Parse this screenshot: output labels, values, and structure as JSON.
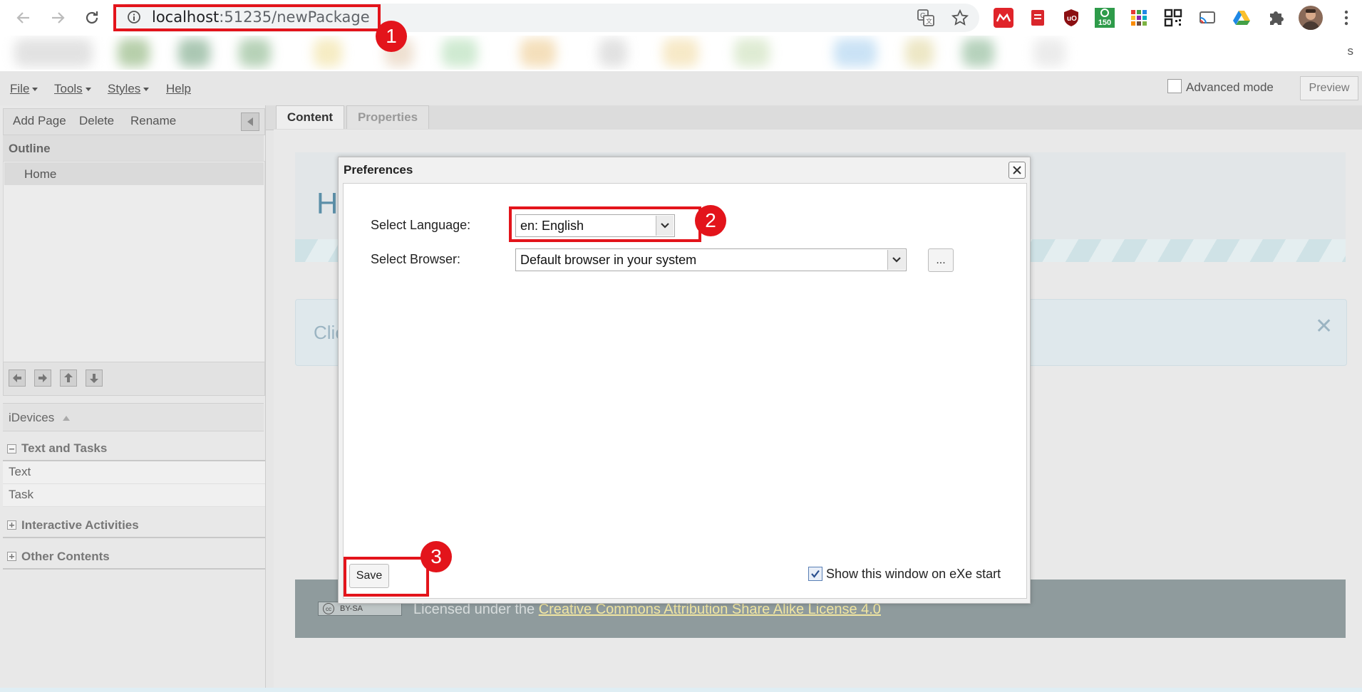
{
  "browser": {
    "url_host": "localhost",
    "url_path": ":51235/newPackage",
    "extension_badge": "150",
    "bookmarks_overflow": "s"
  },
  "menu": {
    "file": "File",
    "tools": "Tools",
    "styles": "Styles",
    "help": "Help",
    "advanced_mode": "Advanced mode",
    "preview": "Preview"
  },
  "outline": {
    "toolbar": {
      "add_page": "Add Page",
      "delete": "Delete",
      "rename": "Rename"
    },
    "title": "Outline",
    "items": [
      "Home"
    ]
  },
  "idevices": {
    "title": "iDevices",
    "categories": [
      {
        "label": "Text and Tasks",
        "items": [
          "Text",
          "Task"
        ]
      },
      {
        "label": "Interactive Activities"
      },
      {
        "label": "Other Contents"
      }
    ]
  },
  "tabs": [
    "Content",
    "Properties"
  ],
  "page": {
    "heading_partial": "H",
    "info_partial": "Clic",
    "license_prefix": "Licensed under the ",
    "license_link": "Creative Commons Attribution Share Alike License 4.0",
    "cc_badge": "BY-SA"
  },
  "dialog": {
    "title": "Preferences",
    "language_label": "Select Language:",
    "language_value": "en: English",
    "browser_label": "Select Browser:",
    "browser_value": "Default browser in your system",
    "browse_button": "...",
    "save_button": "Save",
    "show_on_start_label": "Show this window on eXe start",
    "show_on_start_checked": true
  },
  "annotations": [
    "1",
    "2",
    "3"
  ],
  "colors": {
    "annotation_red": "#e3141b",
    "link_yellow": "#f1e6a2"
  }
}
